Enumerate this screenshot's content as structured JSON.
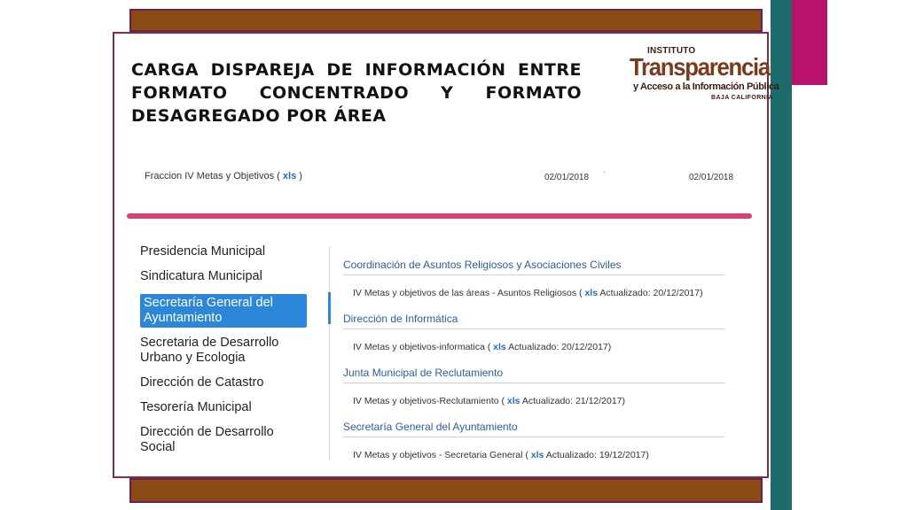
{
  "slide": {
    "title": "CARGA DISPAREJA DE INFORMACIÓN ENTRE FORMATO CONCENTRADO Y FORMATO DESAGREGADO POR ÁREA"
  },
  "logo": {
    "top": "INSTITUTO",
    "main": "Transparencia",
    "sub": "y Acceso a la Información Pública",
    "small": "BAJA CALIFORNIA"
  },
  "fraccion": {
    "prefix": "Fraccion IV Metas y Objetivos ( ",
    "xls": "xls",
    "suffix": " )",
    "date1": "02/01/2018",
    "dot": "·",
    "date2": "02/01/2018"
  },
  "sidebar": {
    "items": [
      {
        "label": "Presidencia Municipal"
      },
      {
        "label": "Sindicatura Municipal"
      },
      {
        "label": "Secretaría General del Ayuntamiento"
      },
      {
        "label": "Secretaria de Desarrollo Urbano y Ecologia"
      },
      {
        "label": "Dirección de Catastro"
      },
      {
        "label": "Tesorería Municipal"
      },
      {
        "label": "Dirección de Desarrollo Social"
      }
    ]
  },
  "sections": [
    {
      "title": "Coordinación de Asuntos Religiosos y Asociaciones Civiles",
      "item_prefix": "IV Metas y objetivos de las áreas - Asuntos Religiosos ( ",
      "xls": "xls",
      "item_suffix": " Actualizado: 20/12/2017)"
    },
    {
      "title": "Dirección de Informática",
      "item_prefix": "IV Metas y objetivos-informatica ( ",
      "xls": "xls",
      "item_suffix": " Actualizado: 20/12/2017)"
    },
    {
      "title": "Junta Municipal de Reclutamiento",
      "item_prefix": "IV Metas y objetivos-Reclutamiento ( ",
      "xls": "xls",
      "item_suffix": " Actualizado: 21/12/2017)"
    },
    {
      "title": "Secretaría General del Ayuntamiento",
      "item_prefix": "IV Metas y objetivos - Secretaria General ( ",
      "xls": "xls",
      "item_suffix": " Actualizado: 19/12/2017)"
    }
  ],
  "colors": {
    "brown": "#8a4b14",
    "teal": "#1e6b6b",
    "magenta": "#b8126a",
    "pink_bar": "#de3f6d",
    "link_blue": "#1f6fc2",
    "active_blue": "#2c87d9"
  }
}
